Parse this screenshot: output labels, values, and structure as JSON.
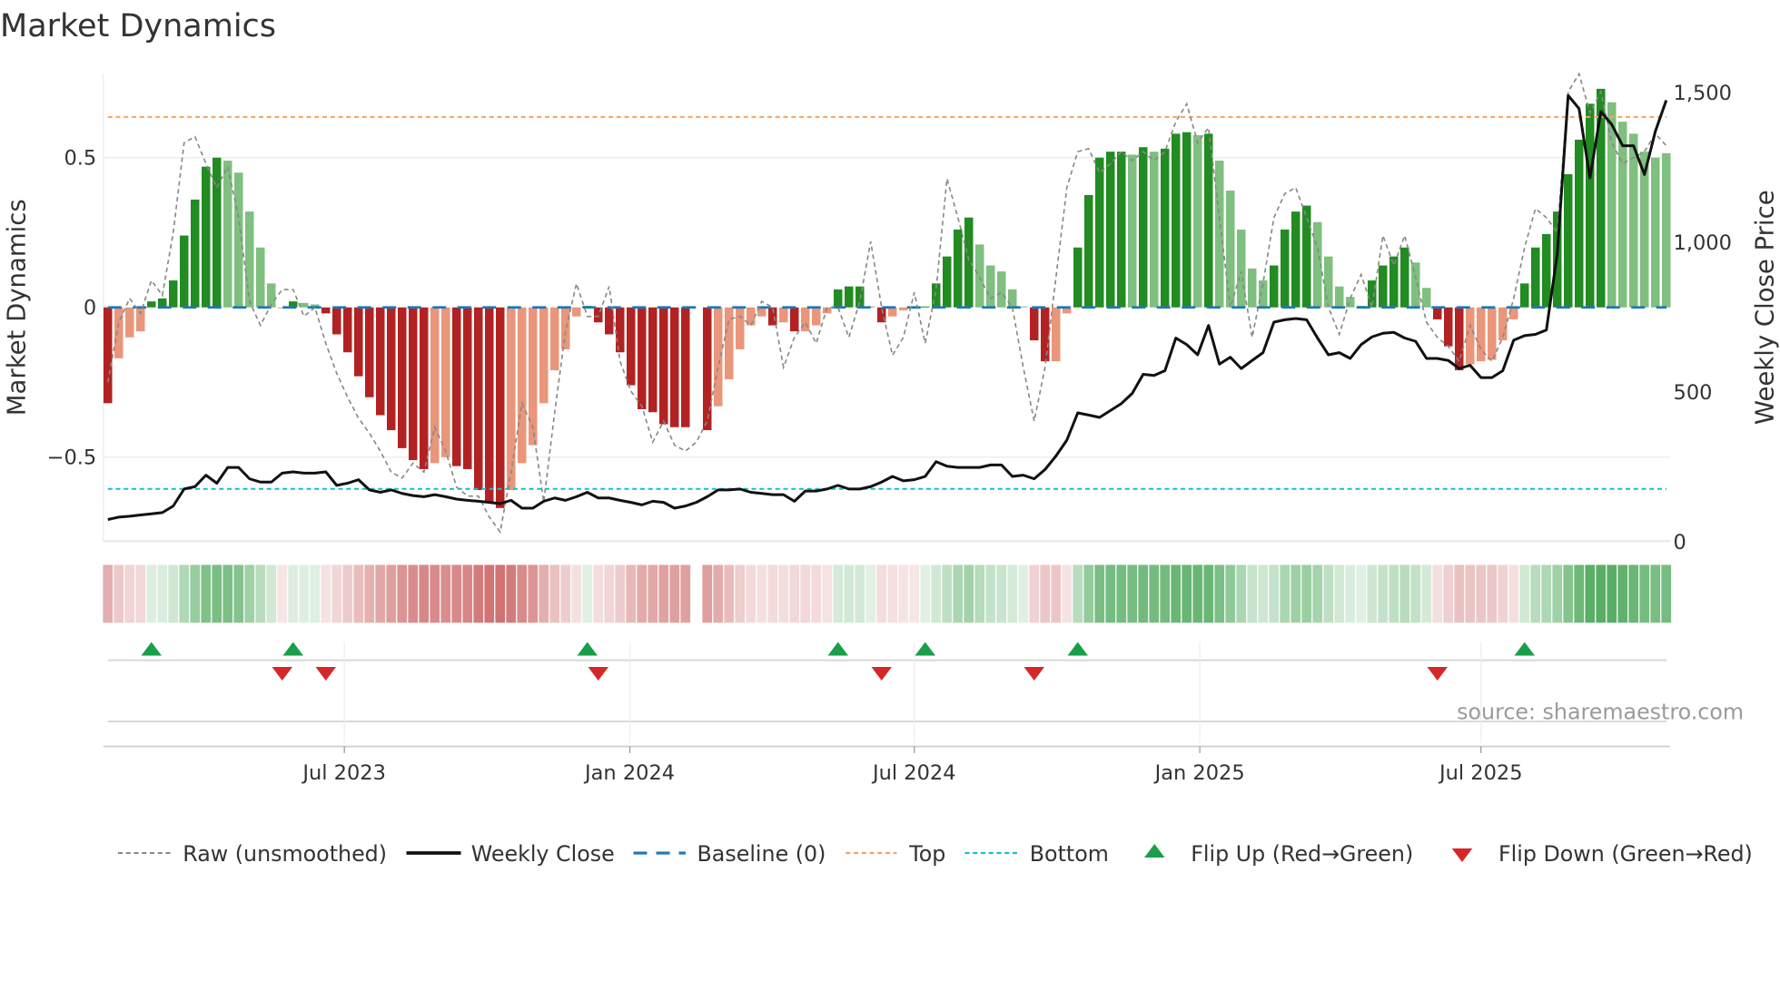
{
  "chart_data": {
    "type": "bar",
    "title": "Market Dynamics",
    "ylabel": "Market Dynamics",
    "y2label": "Weekly Close Price",
    "xlabel": "",
    "ylim": [
      -0.78,
      0.78
    ],
    "y2lim": [
      0,
      1560
    ],
    "yticks": [
      {
        "v": 0.5,
        "label": "0.5"
      },
      {
        "v": 0,
        "label": "0"
      },
      {
        "v": -0.5,
        "label": "−0.5"
      }
    ],
    "y2ticks": [
      {
        "v": 0,
        "label": "0"
      },
      {
        "v": 500,
        "label": "500"
      },
      {
        "v": 1000,
        "label": "1,000"
      },
      {
        "v": 1500,
        "label": "1,500"
      }
    ],
    "xticks": [
      {
        "i": 22.7,
        "label": "Jul 2023"
      },
      {
        "i": 48.9,
        "label": "Jan 2024"
      },
      {
        "i": 75,
        "label": "Jul 2024"
      },
      {
        "i": 101.2,
        "label": "Jan 2025"
      },
      {
        "i": 127,
        "label": "Jul 2025"
      }
    ],
    "x_unit": "week index (1 = first weekly bar, Feb 2023)",
    "top_level": 0.636,
    "bottom_level": -0.606,
    "baseline": 0,
    "dynamics": [
      -0.32,
      -0.17,
      -0.1,
      -0.08,
      0.02,
      0.03,
      0.09,
      0.24,
      0.36,
      0.47,
      0.5,
      0.49,
      0.45,
      0.32,
      0.2,
      0.08,
      -0.003,
      0.02,
      0.015,
      0.01,
      -0.02,
      -0.09,
      -0.15,
      -0.23,
      -0.3,
      -0.36,
      -0.41,
      -0.47,
      -0.51,
      -0.54,
      -0.52,
      -0.5,
      -0.53,
      -0.54,
      -0.61,
      -0.65,
      -0.67,
      -0.61,
      -0.52,
      -0.46,
      -0.32,
      -0.21,
      -0.14,
      -0.03,
      0.005,
      -0.05,
      -0.09,
      -0.15,
      -0.26,
      -0.34,
      -0.35,
      -0.39,
      -0.4,
      -0.4,
      null,
      -0.41,
      -0.33,
      -0.24,
      -0.14,
      -0.06,
      -0.03,
      -0.06,
      -0.05,
      -0.08,
      -0.08,
      -0.06,
      -0.02,
      0.06,
      0.07,
      0.07,
      0.003,
      -0.05,
      -0.03,
      -0.01,
      -0.003,
      0.003,
      0.08,
      0.17,
      0.26,
      0.3,
      0.21,
      0.14,
      0.12,
      0.06,
      0.003,
      -0.11,
      -0.18,
      -0.18,
      -0.02,
      0.2,
      0.375,
      0.5,
      0.52,
      0.52,
      0.51,
      0.535,
      0.52,
      0.53,
      0.58,
      0.585,
      0.575,
      0.58,
      0.49,
      0.39,
      0.26,
      0.13,
      0.09,
      0.14,
      0.26,
      0.32,
      0.34,
      0.285,
      0.17,
      0.07,
      0.035,
      0.005,
      0.09,
      0.14,
      0.17,
      0.2,
      0.15,
      0.065,
      -0.04,
      -0.13,
      -0.21,
      -0.19,
      -0.18,
      -0.175,
      -0.11,
      -0.04,
      0.08,
      0.2,
      0.245,
      0.32,
      0.445,
      0.56,
      0.68,
      0.73,
      0.685,
      0.62,
      0.58,
      0.52,
      0.5,
      0.515
    ],
    "bar_state": "RrrrGGGGGGGgggggrGggRRRRRRRRRRrrRRRRRrrrrrrrGRRRRRRRRR-RrrrrrRrRrrrGGGgRrrrGGGGGgggggRRrrGGGGGgGgGGGgGgggggGGGGgggggGGGGggRRRrrrrrGGGGGGGGggggggG",
    "bar_state_colors": {
      "G": "#228b22",
      "g": "#7fbf7f",
      "R": "#b22222",
      "r": "#e9967a"
    },
    "raw": [
      -0.25,
      -0.05,
      0.03,
      -0.02,
      0.09,
      0.04,
      0.25,
      0.55,
      0.57,
      0.48,
      0.4,
      0.47,
      0.3,
      0.02,
      -0.06,
      0.01,
      0.06,
      0.06,
      -0.03,
      0.0,
      -0.12,
      -0.22,
      -0.3,
      -0.37,
      -0.42,
      -0.48,
      -0.55,
      -0.57,
      -0.52,
      -0.55,
      -0.4,
      -0.48,
      -0.6,
      -0.63,
      -0.63,
      -0.7,
      -0.75,
      -0.55,
      -0.32,
      -0.4,
      -0.65,
      -0.35,
      -0.08,
      0.08,
      -0.03,
      -0.03,
      0.07,
      -0.18,
      -0.28,
      -0.33,
      -0.45,
      -0.38,
      -0.46,
      -0.48,
      -0.45,
      -0.38,
      -0.2,
      -0.04,
      -0.03,
      -0.06,
      0.02,
      0.0,
      -0.2,
      -0.1,
      -0.05,
      -0.12,
      0.0,
      0.0,
      -0.1,
      0.02,
      0.22,
      0.0,
      -0.16,
      -0.1,
      0.05,
      -0.12,
      0.06,
      0.43,
      0.3,
      0.16,
      0.1,
      0.03,
      0.05,
      0.0,
      -0.2,
      -0.38,
      -0.2,
      0.1,
      0.4,
      0.52,
      0.53,
      0.45,
      0.48,
      0.52,
      0.49,
      0.52,
      0.49,
      0.52,
      0.62,
      0.68,
      0.55,
      0.6,
      0.3,
      0.0,
      0.12,
      -0.1,
      0.08,
      0.3,
      0.38,
      0.4,
      0.3,
      0.2,
      0.0,
      -0.09,
      0.03,
      0.11,
      0.0,
      0.24,
      0.14,
      0.24,
      0.1,
      -0.05,
      -0.1,
      -0.13,
      -0.18,
      -0.06,
      -0.14,
      -0.18,
      -0.1,
      0.03,
      0.2,
      0.33,
      0.3,
      0.25,
      0.72,
      0.78,
      0.65,
      0.72,
      0.55,
      0.48,
      0.5,
      0.52,
      0.58,
      0.54
    ],
    "close": [
      72,
      80,
      83,
      87,
      91,
      95,
      117,
      174,
      182,
      220,
      193,
      246,
      246,
      208,
      197,
      197,
      227,
      231,
      227,
      227,
      231,
      186,
      193,
      205,
      171,
      163,
      171,
      159,
      152,
      148,
      155,
      148,
      140,
      136,
      133,
      129,
      125,
      136,
      110,
      110,
      133,
      144,
      136,
      148,
      163,
      144,
      144,
      136,
      129,
      121,
      133,
      129,
      110,
      117,
      129,
      148,
      171,
      171,
      174,
      163,
      159,
      155,
      155,
      133,
      167,
      167,
      174,
      186,
      174,
      174,
      182,
      197,
      216,
      201,
      205,
      216,
      265,
      250,
      246,
      246,
      246,
      254,
      254,
      216,
      220,
      208,
      239,
      284,
      337,
      428,
      421,
      413,
      436,
      459,
      493,
      557,
      553,
      569,
      678,
      656,
      622,
      720,
      591,
      614,
      576,
      603,
      629,
      731,
      739,
      743,
      739,
      678,
      622,
      629,
      610,
      656,
      682,
      694,
      697,
      678,
      667,
      610,
      610,
      603,
      576,
      587,
      546,
      546,
      569,
      671,
      686,
      690,
      705,
      959,
      1488,
      1444,
      1213,
      1434,
      1391,
      1320,
      1320,
      1224,
      1368,
      1472
    ],
    "flip_up": [
      5,
      18,
      45,
      68,
      76,
      90,
      131
    ],
    "flip_down": [
      17,
      21,
      46,
      72,
      86,
      123
    ],
    "colors": {
      "raw": "#888888",
      "close": "#111111",
      "baseline": "#1f77b4",
      "top": "#f4a460",
      "bottom": "#17becf",
      "flip_up": "#1a9e4a",
      "flip_down": "#d62728"
    },
    "legend": {
      "placement": "bottom",
      "raw": "Raw (unsmoothed)",
      "close": "Weekly Close",
      "baseline": "Baseline (0)",
      "top": "Top",
      "bottom": "Bottom",
      "flip_up": "Flip Up (Red→Green)",
      "flip_down": "Flip Down (Green→Red)"
    },
    "source": "source: sharemaestro.com"
  }
}
